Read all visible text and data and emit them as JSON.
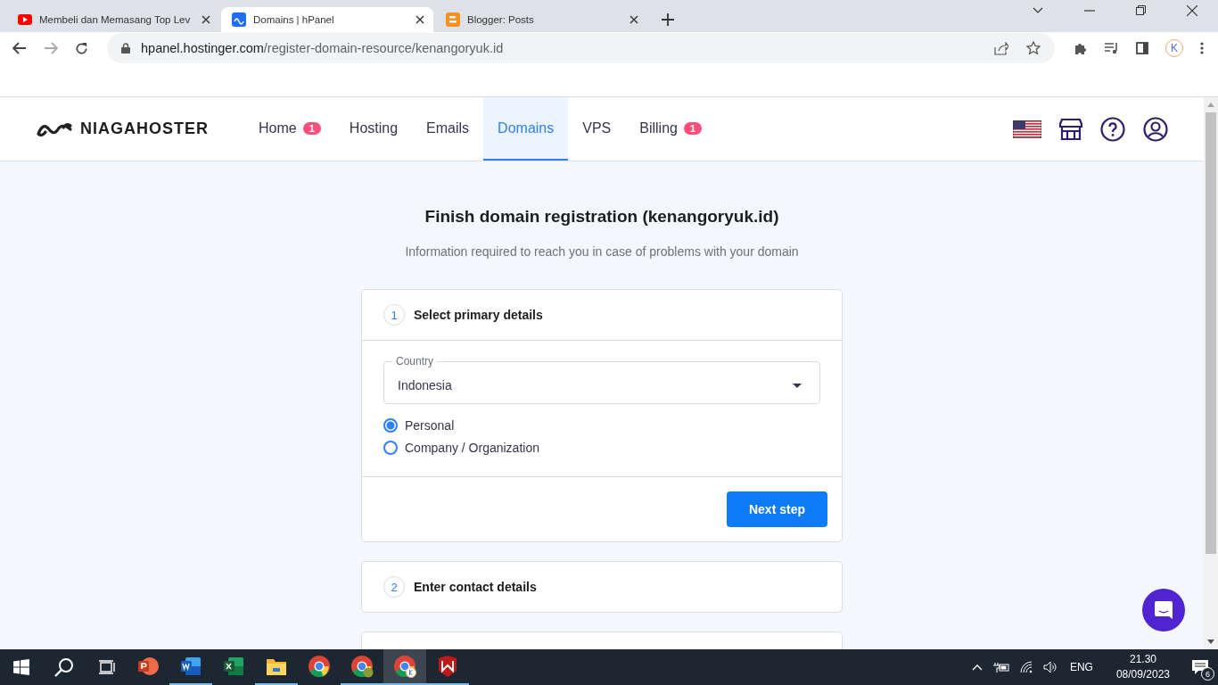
{
  "browser": {
    "tabs": [
      {
        "title": "Membeli dan Memasang Top Lev",
        "selected": false
      },
      {
        "title": "Domains | hPanel",
        "selected": true
      },
      {
        "title": "Blogger: Posts",
        "selected": false
      }
    ],
    "address": {
      "host": "hpanel.hostinger.com",
      "path": "/register-domain-resource/kenangoryuk.id"
    },
    "profile_letter": "K"
  },
  "nav": {
    "logo": "NIAGAHOSTER",
    "items": [
      {
        "label": "Home",
        "badge": "1",
        "selected": false
      },
      {
        "label": "Hosting",
        "selected": false
      },
      {
        "label": "Emails",
        "selected": false
      },
      {
        "label": "Domains",
        "selected": true
      },
      {
        "label": "VPS",
        "selected": false
      },
      {
        "label": "Billing",
        "badge": "1",
        "selected": false
      }
    ]
  },
  "page": {
    "title": "Finish domain registration (kenangoryuk.id)",
    "subtitle": "Information required to reach you in case of problems with your domain",
    "steps": [
      {
        "number": "1",
        "title": "Select primary details",
        "expanded": true,
        "country": {
          "label": "Country",
          "value": "Indonesia"
        },
        "options": [
          {
            "label": "Personal",
            "selected": true
          },
          {
            "label": "Company / Organization",
            "selected": false
          }
        ],
        "button": "Next step"
      },
      {
        "number": "2",
        "title": "Enter contact details",
        "expanded": false
      }
    ]
  },
  "taskbar": {
    "apps": [
      {
        "running": false,
        "selected": false
      },
      {
        "running": true,
        "selected": false
      },
      {
        "running": false,
        "selected": false
      },
      {
        "running": true,
        "selected": false
      },
      {
        "running": false,
        "selected": false
      },
      {
        "running": true,
        "selected": false
      },
      {
        "running": true,
        "selected": true
      },
      {
        "running": true,
        "selected": false
      }
    ],
    "language": "ENG",
    "time": "21.30",
    "date": "08/09/2023",
    "notifications": "6"
  }
}
